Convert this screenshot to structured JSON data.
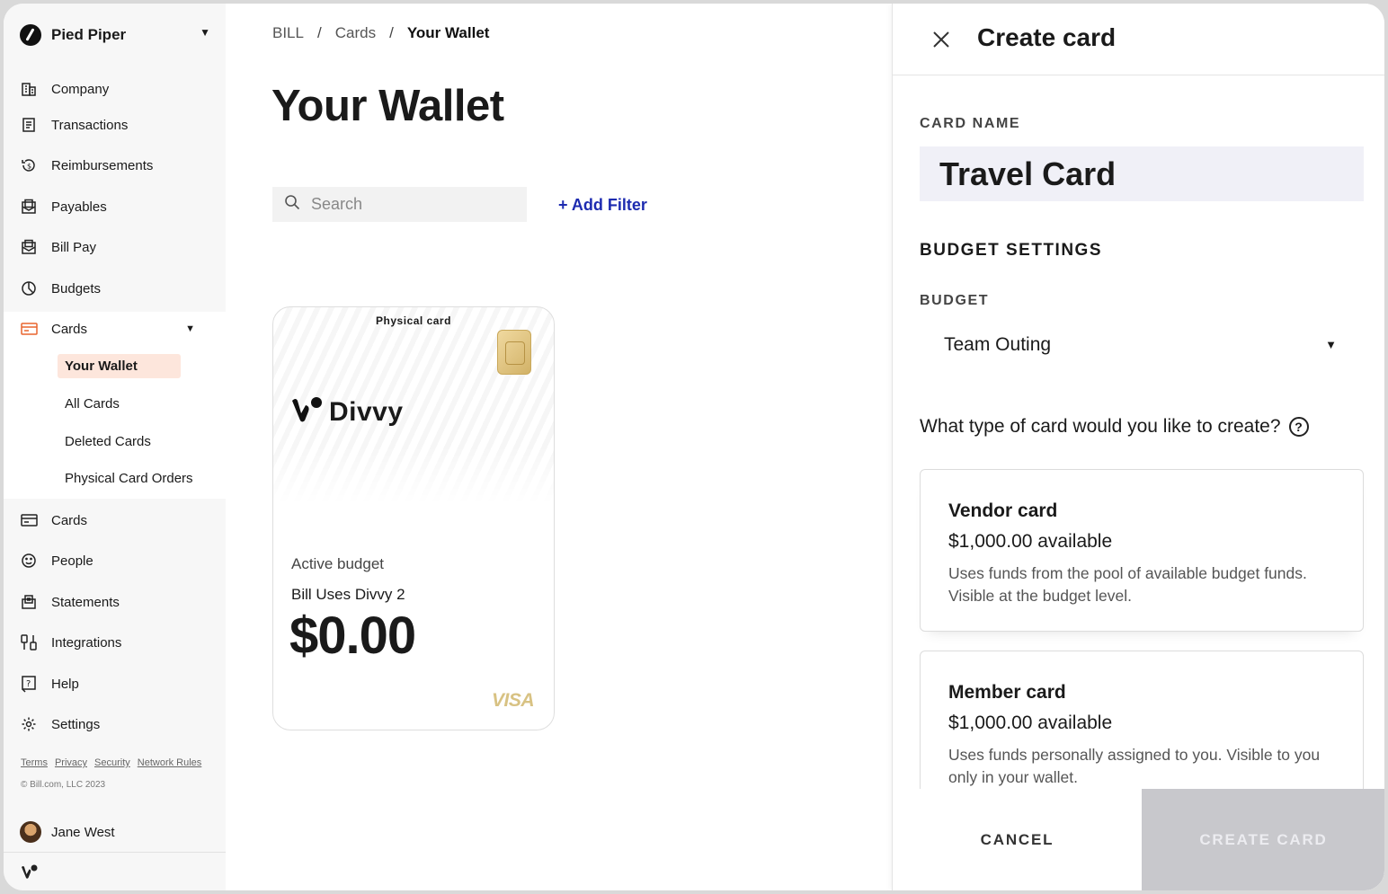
{
  "sidebar": {
    "org_name": "Pied Piper",
    "items": [
      {
        "label": "Company",
        "icon": "building-icon"
      },
      {
        "label": "Transactions",
        "icon": "receipt-icon"
      },
      {
        "label": "Reimbursements",
        "icon": "refund-icon"
      },
      {
        "label": "Payables",
        "icon": "invoice-icon"
      },
      {
        "label": "Bill Pay",
        "icon": "bill-pay-icon"
      },
      {
        "label": "Budgets",
        "icon": "pie-icon"
      },
      {
        "label": "Cards",
        "icon": "card-icon"
      },
      {
        "label": "Cards",
        "icon": "card-icon"
      },
      {
        "label": "People",
        "icon": "smile-icon"
      },
      {
        "label": "Statements",
        "icon": "statement-icon"
      },
      {
        "label": "Integrations",
        "icon": "integrations-icon"
      },
      {
        "label": "Help",
        "icon": "help-icon"
      },
      {
        "label": "Settings",
        "icon": "gear-icon"
      }
    ],
    "cards_sub": [
      "Your Wallet",
      "All Cards",
      "Deleted Cards",
      "Physical Card Orders"
    ],
    "footer_links": [
      "Terms",
      "Privacy",
      "Security",
      "Network Rules"
    ],
    "copyright": "© Bill.com, LLC 2023",
    "user_name": "Jane West"
  },
  "main": {
    "breadcrumb": [
      "BILL",
      "Cards",
      "Your Wallet"
    ],
    "title": "Your Wallet",
    "search_placeholder": "Search",
    "add_filter": "+ Add Filter",
    "card": {
      "type": "Physical card",
      "brand": "Divvy",
      "label": "Active budget",
      "budget": "Bill Uses Divvy 2",
      "amount": "$0.00",
      "network": "VISA"
    }
  },
  "panel": {
    "title": "Create card",
    "card_name_label": "CARD NAME",
    "card_name_value": "Travel Card",
    "budget_settings": "BUDGET SETTINGS",
    "budget_label": "BUDGET",
    "budget_value": "Team Outing",
    "question": "What type of card would you like to create?",
    "options": [
      {
        "title": "Vendor card",
        "available": "$1,000.00 available",
        "desc": "Uses funds from the pool of available budget funds. Visible at the budget level."
      },
      {
        "title": "Member card",
        "available": "$1,000.00 available",
        "desc": "Uses funds personally assigned to you. Visible to you only in your wallet."
      }
    ],
    "cancel": "CANCEL",
    "create": "CREATE CARD"
  },
  "colors": {
    "accent_link": "#1d2bb0",
    "active_nav_bg": "#fde6dc",
    "cards_icon": "#e8652e"
  }
}
